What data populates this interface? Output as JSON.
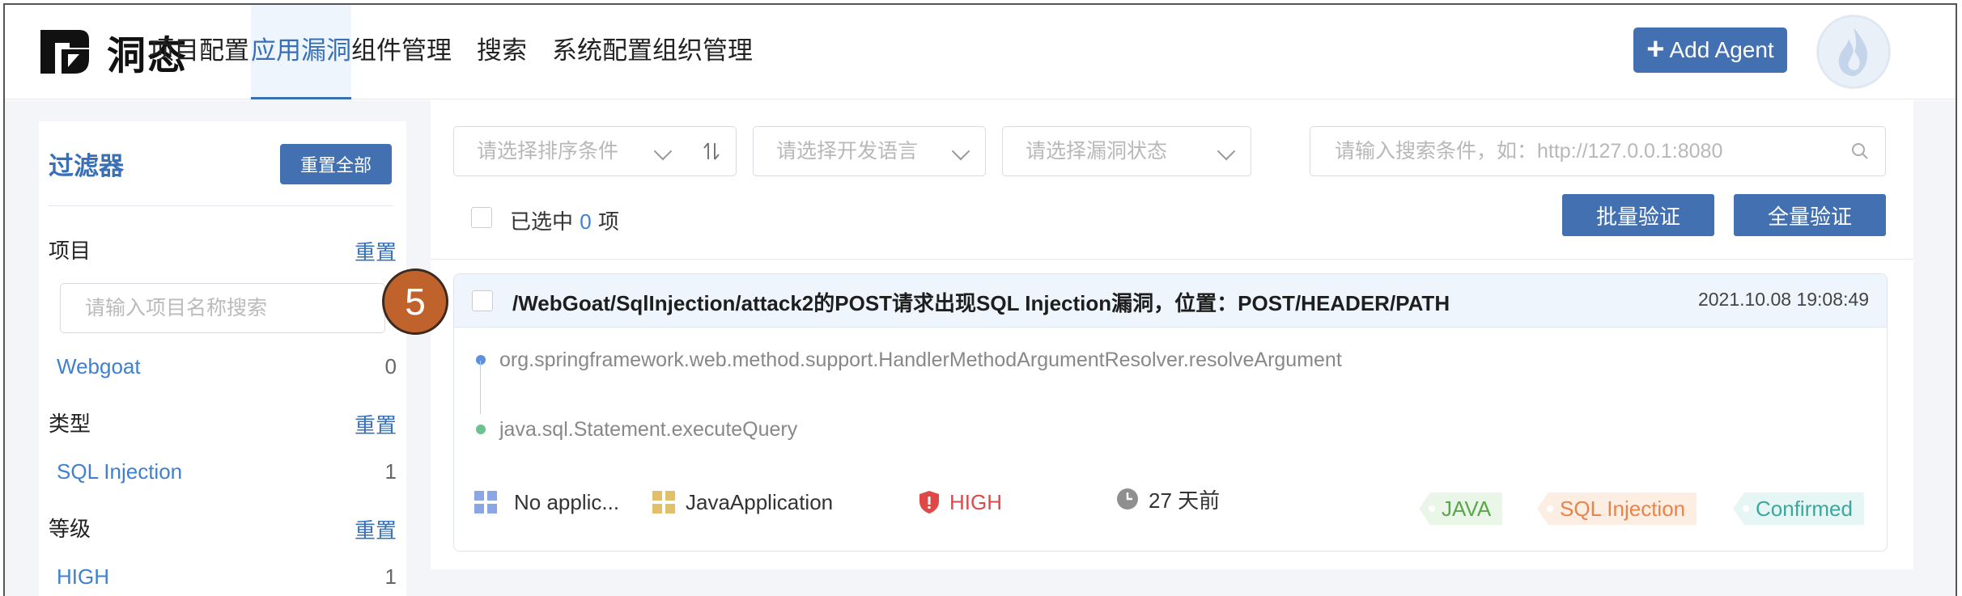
{
  "app": {
    "logo_text": "洞态",
    "nav": [
      {
        "label": "项目配置",
        "active": false
      },
      {
        "label": "应用漏洞",
        "active": true
      },
      {
        "label": "组件管理",
        "active": false
      },
      {
        "label": "搜索",
        "active": false
      },
      {
        "label": "系统配置",
        "active": false
      },
      {
        "label": "组织管理",
        "active": false
      }
    ],
    "add_agent_label": "Add Agent"
  },
  "sidebar": {
    "title": "过滤器",
    "reset_all_label": "重置全部",
    "project": {
      "label": "项目",
      "reset_label": "重置",
      "search_placeholder": "请输入项目名称搜索",
      "items": [
        {
          "name": "Webgoat",
          "count": "0"
        }
      ]
    },
    "type": {
      "label": "类型",
      "reset_label": "重置",
      "items": [
        {
          "name": "SQL Injection",
          "count": "1"
        }
      ]
    },
    "level": {
      "label": "等级",
      "reset_label": "重置",
      "items": [
        {
          "name": "HIGH",
          "count": "1"
        }
      ]
    }
  },
  "toolbar": {
    "sort_placeholder": "请选择排序条件",
    "language_placeholder": "请选择开发语言",
    "status_placeholder": "请选择漏洞状态",
    "search_placeholder": "请输入搜索条件，如：http://127.0.0.1:8080",
    "selected_prefix": "已选中",
    "selected_count": "0",
    "selected_suffix": "项",
    "batch_verify_label": "批量验证",
    "all_verify_label": "全量验证"
  },
  "vulnerability": {
    "title": "/WebGoat/SqlInjection/attack2的POST请求出现SQL Injection漏洞，位置：POST/HEADER/PATH",
    "time": "2021.10.08 19:08:49",
    "stack": [
      {
        "text": "org.springframework.web.method.support.HandlerMethodArgumentResolver.resolveArgument",
        "color": "#5b8fe0"
      },
      {
        "text": "java.sql.Statement.executeQuery",
        "color": "#6cc28f"
      }
    ],
    "meta": {
      "app": "No applic...",
      "app_type": "JavaApplication",
      "level": "HIGH",
      "age": "27 天前"
    },
    "tags": [
      {
        "label": "JAVA",
        "bg": "#eaf6e8",
        "color": "#5aa74a"
      },
      {
        "label": "SQL Injection",
        "bg": "#fdeee3",
        "color": "#e8844a"
      },
      {
        "label": "Confirmed",
        "bg": "#e6f6f4",
        "color": "#3aa89c"
      }
    ]
  },
  "step_badge": "5",
  "colors": {
    "accent": "#3870b8",
    "primary_button": "#4270b0",
    "high": "#e04848"
  }
}
